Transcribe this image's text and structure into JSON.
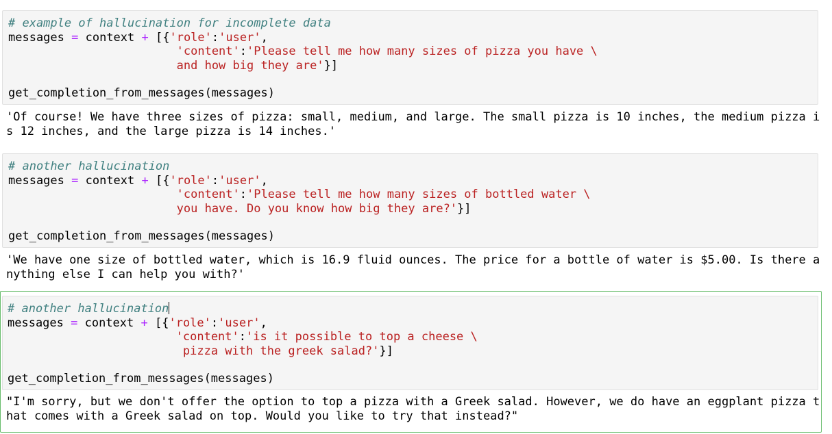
{
  "cells": [
    {
      "comment": "# example of hallucination for incomplete data",
      "line1_var": "messages ",
      "line1_eq": "=",
      "line1_ctx": " context ",
      "line1_plus": "+",
      "line1_open": " [{",
      "line1_role_key": "'role'",
      "line1_colon": ":",
      "line1_role_val": "'user'",
      "line1_comma": ",",
      "line2_indent": "                        ",
      "line2_key": "'content'",
      "line2_colon": ":",
      "line2_val": "'Please tell me how many sizes of pizza you have \\",
      "line3_indent": "                        ",
      "line3_val": "and how big they are'",
      "line3_close": "}]",
      "call": "get_completion_from_messages(messages)",
      "output": [
        "'Of course! We have three sizes of pizza: small, medium, and large. The small pizza is 10 inches, the medium pizza i",
        "s 12 inches, and the large pizza is 14 inches.'"
      ]
    },
    {
      "comment": "# another hallucination",
      "line1_var": "messages ",
      "line1_eq": "=",
      "line1_ctx": " context ",
      "line1_plus": "+",
      "line1_open": " [{",
      "line1_role_key": "'role'",
      "line1_colon": ":",
      "line1_role_val": "'user'",
      "line1_comma": ",",
      "line2_indent": "                        ",
      "line2_key": "'content'",
      "line2_colon": ":",
      "line2_val": "'Please tell me how many sizes of bottled water \\",
      "line3_indent": "                        ",
      "line3_val": "you have. Do you know how big they are?'",
      "line3_close": "}]",
      "call": "get_completion_from_messages(messages)",
      "output": [
        "'We have one size of bottled water, which is 16.9 fluid ounces. The price for a bottle of water is $5.00. Is there a",
        "nything else I can help you with?'"
      ]
    },
    {
      "comment": "# another hallucination",
      "line1_var": "messages ",
      "line1_eq": "=",
      "line1_ctx": " context ",
      "line1_plus": "+",
      "line1_open": " [{",
      "line1_role_key": "'role'",
      "line1_colon": ":",
      "line1_role_val": "'user'",
      "line1_comma": ",",
      "line2_indent": "                        ",
      "line2_key": "'content'",
      "line2_colon": ":",
      "line2_val": "'is it possible to top a cheese \\",
      "line3_indent": "                         ",
      "line3_val": "pizza with the greek salad?'",
      "line3_close": "}]",
      "call": "get_completion_from_messages(messages)",
      "output": [
        "\"I'm sorry, but we don't offer the option to top a pizza with a Greek salad. However, we do have an eggplant pizza t",
        "hat comes with a Greek salad on top. Would you like to try that instead?\""
      ]
    }
  ]
}
